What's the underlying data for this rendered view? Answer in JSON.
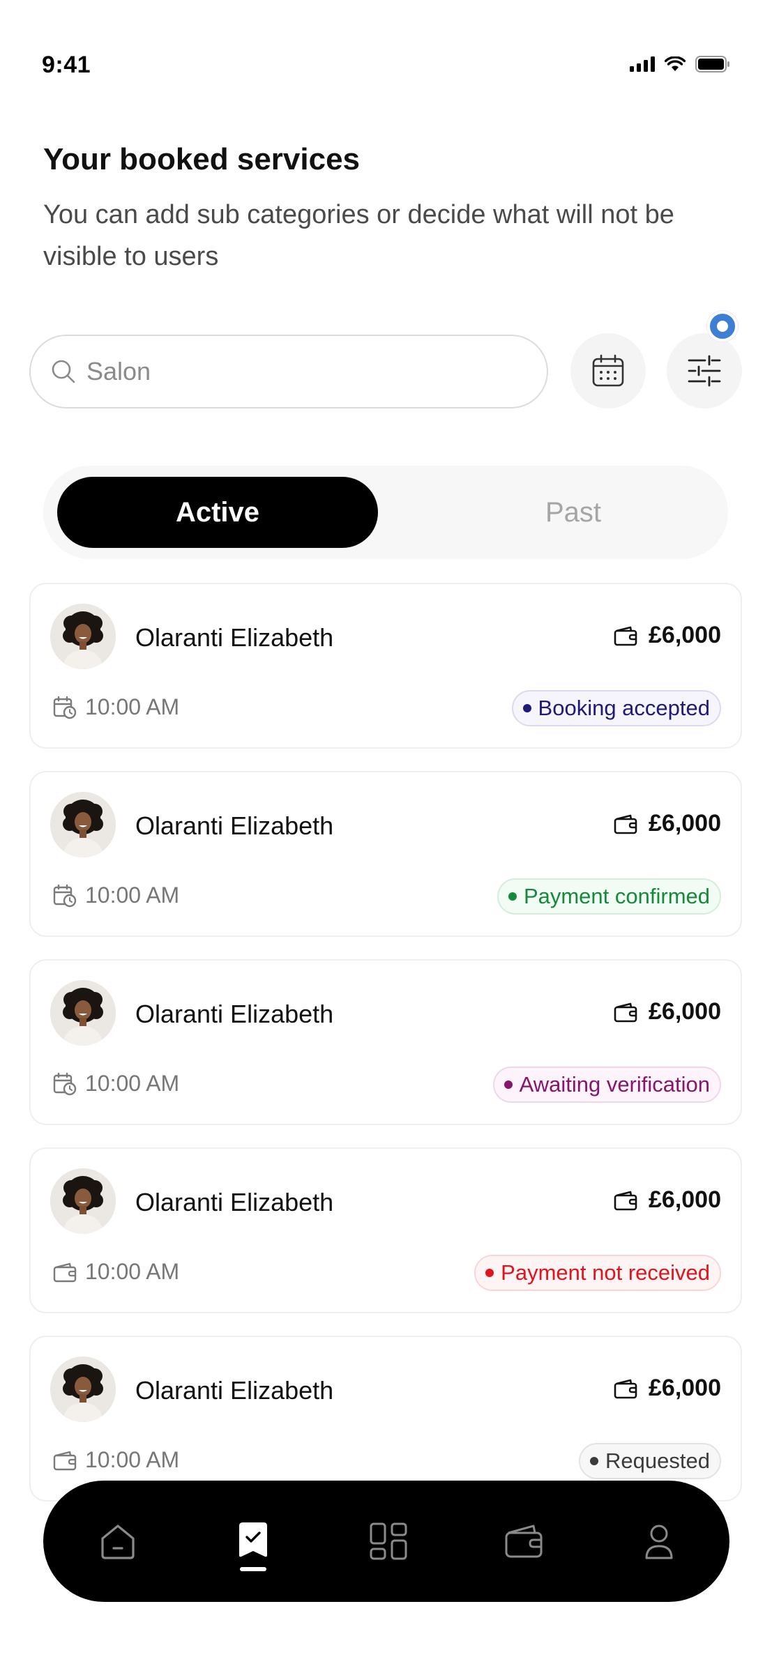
{
  "status_bar": {
    "time": "9:41"
  },
  "header": {
    "title": "Your booked services",
    "subtitle": "You can add sub categories or decide what will not be visible to users"
  },
  "search": {
    "placeholder": "Salon",
    "value": ""
  },
  "tabs": [
    {
      "label": "Active",
      "selected": true
    },
    {
      "label": "Past",
      "selected": false
    }
  ],
  "bookings": [
    {
      "name": "Olaranti Elizabeth",
      "price": "£6,000",
      "time": "10:00 AM",
      "time_icon": "calendar-clock-icon",
      "status": "Booking accepted",
      "status_color": "#1f1a7a",
      "status_bg": "#f6f5fc",
      "status_border": "#dcd9f2"
    },
    {
      "name": "Olaranti Elizabeth",
      "price": "£6,000",
      "time": "10:00 AM",
      "time_icon": "calendar-clock-icon",
      "status": "Payment confirmed",
      "status_color": "#148a3a",
      "status_bg": "#f3fbf5",
      "status_border": "#d3eedb"
    },
    {
      "name": "Olaranti Elizabeth",
      "price": "£6,000",
      "time": "10:00 AM",
      "time_icon": "calendar-clock-icon",
      "status": "Awaiting verification",
      "status_color": "#86156b",
      "status_bg": "#fcf4fa",
      "status_border": "#f0d6ea"
    },
    {
      "name": "Olaranti Elizabeth",
      "price": "£6,000",
      "time": "10:00 AM",
      "time_icon": "wallet-icon",
      "status": "Payment not received",
      "status_color": "#e0141e",
      "status_bg": "#fff4f4",
      "status_border": "#f9d5d6"
    },
    {
      "name": "Olaranti Elizabeth",
      "price": "£6,000",
      "time": "10:00 AM",
      "time_icon": "wallet-icon",
      "status": "Requested",
      "status_color": "#3b3b3b",
      "status_bg": "#f7f7f7",
      "status_border": "#e2e2e2"
    }
  ],
  "bottom_nav": [
    {
      "icon": "home-icon",
      "active": false
    },
    {
      "icon": "bookings-icon",
      "active": true
    },
    {
      "icon": "grid-icon",
      "active": false
    },
    {
      "icon": "wallet-icon",
      "active": false
    },
    {
      "icon": "profile-icon",
      "active": false
    }
  ],
  "colors": {
    "accent": "#000000",
    "notification_dot": "#3e7fd6"
  }
}
